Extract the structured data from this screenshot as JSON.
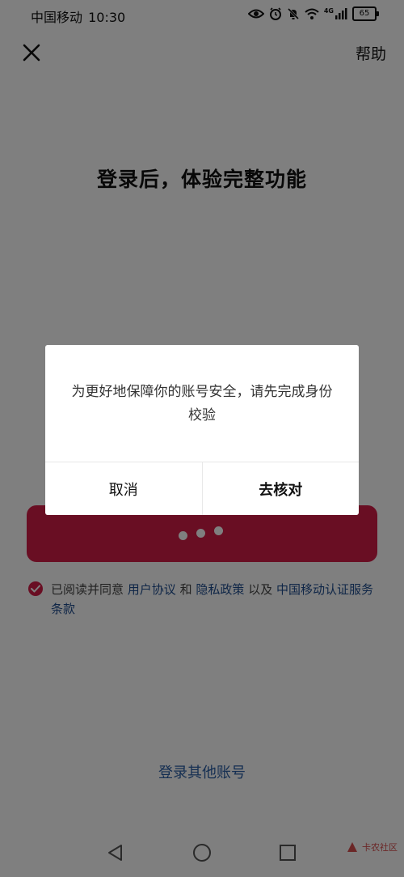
{
  "status_bar": {
    "carrier": "中国移动",
    "time": "10:30",
    "network": "4G",
    "battery": "65",
    "icons": [
      "eye-icon",
      "alarm-icon",
      "mute-bell-icon",
      "wifi-icon",
      "signal-icon",
      "battery-icon"
    ]
  },
  "header": {
    "close_icon": "close-icon",
    "help_label": "帮助"
  },
  "headline": "登录后，体验完整功能",
  "login_button": {
    "loading_dots": 3,
    "color": "#d31d46"
  },
  "agreement": {
    "checked": true,
    "prefix": "已阅读并同意",
    "user_agreement": "用户协议",
    "and": "和",
    "privacy_policy": "隐私政策",
    "and2": "以及",
    "cmcc_terms": "中国移动认证服务条款"
  },
  "other_account_label": "登录其他账号",
  "nav": {
    "back_icon": "back-triangle-icon",
    "home_icon": "home-circle-icon",
    "recents_icon": "recents-square-icon"
  },
  "watermark": {
    "text": "卡农社区"
  },
  "dialog": {
    "message": "为更好地保障你的账号安全，请先完成身份校验",
    "cancel_label": "取消",
    "confirm_label": "去核对"
  }
}
